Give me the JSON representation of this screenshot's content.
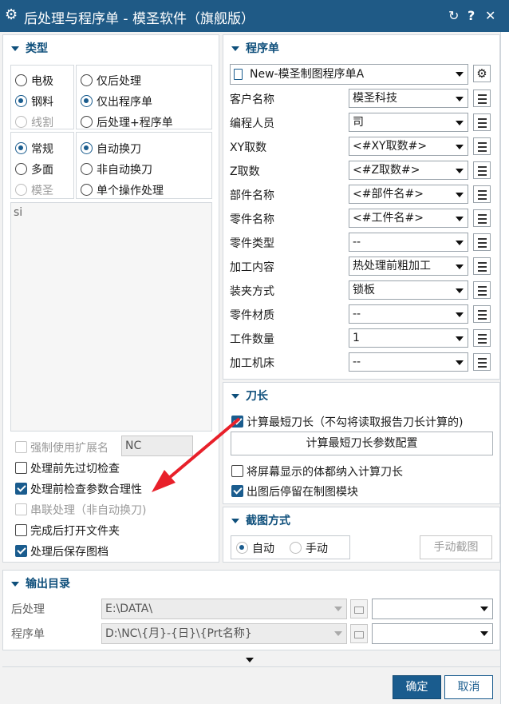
{
  "window": {
    "title": "后处理与程序单 - 模圣软件（旗舰版）",
    "settings_icon": "gear-icon",
    "refresh_icon": "refresh-icon",
    "help_label": "?",
    "close_label": "✕"
  },
  "type_panel": {
    "header": "类型",
    "group1": {
      "left": [
        {
          "label": "电极",
          "checked": false,
          "disabled": false
        },
        {
          "label": "钢料",
          "checked": true,
          "disabled": false
        },
        {
          "label": "线割",
          "checked": false,
          "disabled": true
        }
      ],
      "right": [
        {
          "label": "仅后处理",
          "checked": false
        },
        {
          "label": "仅出程序单",
          "checked": true
        },
        {
          "label": "后处理+程序单",
          "checked": false
        }
      ]
    },
    "group2": {
      "left": [
        {
          "label": "常规",
          "checked": true,
          "disabled": false
        },
        {
          "label": "多面",
          "checked": false,
          "disabled": false
        },
        {
          "label": "模圣",
          "checked": false,
          "disabled": true
        }
      ],
      "right": [
        {
          "label": "自动换刀",
          "checked": true
        },
        {
          "label": "非自动换刀",
          "checked": false
        },
        {
          "label": "单个操作处理",
          "checked": false
        }
      ]
    },
    "list_text": "si",
    "force_ext": {
      "label": "强制使用扩展名",
      "checked": false,
      "disabled": true,
      "value": "NC"
    },
    "options": [
      {
        "label": "处理前先过切检查",
        "checked": false,
        "disabled": false
      },
      {
        "label": "处理前检查参数合理性",
        "checked": true,
        "disabled": false
      },
      {
        "label": "串联处理（非自动换刀)",
        "checked": false,
        "disabled": true
      },
      {
        "label": "完成后打开文件夹",
        "checked": false,
        "disabled": false
      },
      {
        "label": "处理后保存图档",
        "checked": true,
        "disabled": false
      }
    ]
  },
  "program_panel": {
    "header": "程序单",
    "template": "New-模圣制图程序单A",
    "fields": [
      {
        "label": "客户名称",
        "value": "模圣科技"
      },
      {
        "label": "编程人员",
        "value": "司"
      },
      {
        "label": "XY取数",
        "value": "<#XY取数#>"
      },
      {
        "label": "Z取数",
        "value": "<#Z取数#>"
      },
      {
        "label": "部件名称",
        "value": "<#部件名#>"
      },
      {
        "label": "零件名称",
        "value": "<#工件名#>"
      },
      {
        "label": "零件类型",
        "value": "--"
      },
      {
        "label": "加工内容",
        "value": "热处理前粗加工"
      },
      {
        "label": "装夹方式",
        "value": "锁板"
      },
      {
        "label": "零件材质",
        "value": "--"
      },
      {
        "label": "工件数量",
        "value": "1"
      },
      {
        "label": "加工机床",
        "value": "--"
      }
    ]
  },
  "tool_length_panel": {
    "header": "刀长",
    "calc_shortest": {
      "label": "计算最短刀长（不勾将读取报告刀长计算的)",
      "checked": true
    },
    "config_button": "计算最短刀长参数配置",
    "include_screen": {
      "label": "将屏幕显示的体都纳入计算刀长",
      "checked": false
    },
    "stay_module": {
      "label": "出图后停留在制图模块",
      "checked": true
    }
  },
  "screenshot_panel": {
    "header": "截图方式",
    "auto": {
      "label": "自动",
      "checked": true
    },
    "manual": {
      "label": "手动",
      "checked": false
    },
    "manual_button": "手动截图"
  },
  "output_panel": {
    "header": "输出目录",
    "rows": [
      {
        "label": "后处理",
        "path": "E:\\DATA\\",
        "ext": ""
      },
      {
        "label": "程序单",
        "path": "D:\\NC\\{月}-{日}\\{Prt名称}",
        "ext": ""
      }
    ]
  },
  "footer": {
    "ok": "确定",
    "cancel": "取消"
  },
  "colors": {
    "titlebar": "#1f5a86",
    "accent": "#1a5c8e",
    "arrow": "#e8202a"
  }
}
